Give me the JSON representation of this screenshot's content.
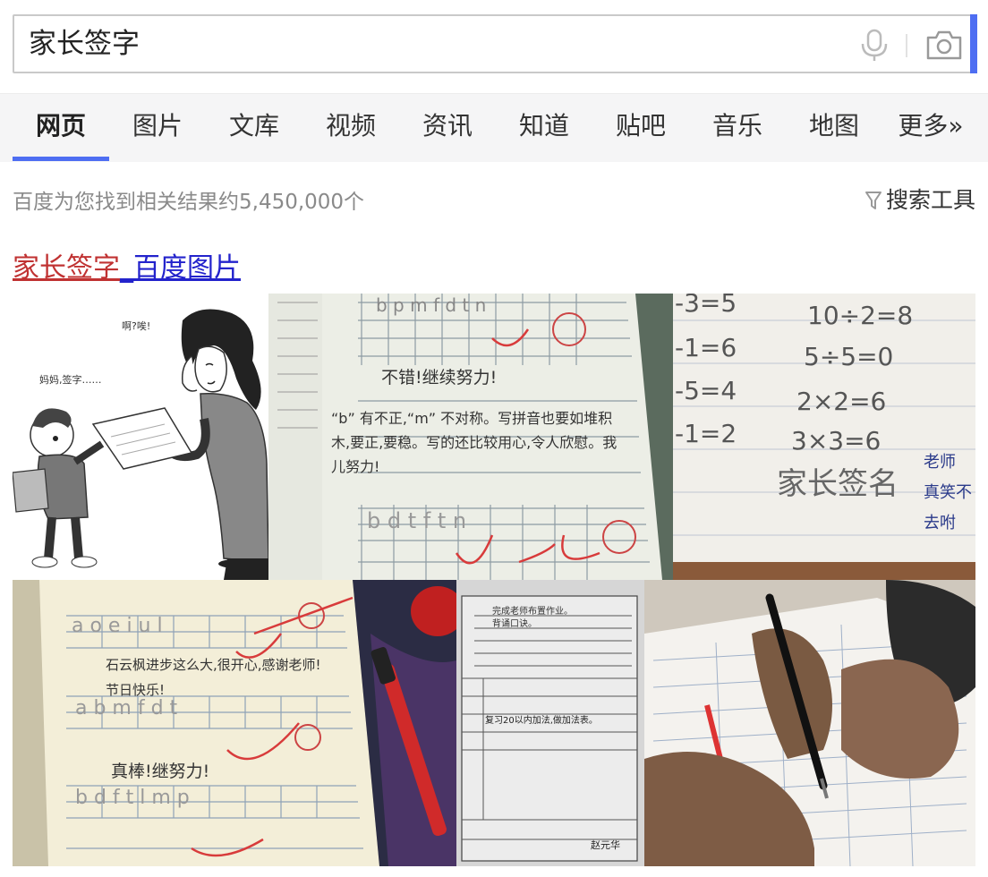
{
  "search": {
    "query": "家长签字"
  },
  "tabs": [
    {
      "label": "网页",
      "active": true
    },
    {
      "label": "图片"
    },
    {
      "label": "文库"
    },
    {
      "label": "视频"
    },
    {
      "label": "资讯"
    },
    {
      "label": "知道"
    },
    {
      "label": "贴吧"
    },
    {
      "label": "音乐"
    },
    {
      "label": "地图"
    },
    {
      "label": "更多»"
    }
  ],
  "results": {
    "count_text": "百度为您找到相关结果约5,450,000个",
    "tools_label": "搜索工具"
  },
  "result_title": {
    "keyword": "家长签字",
    "rest": "_百度图片"
  },
  "images": {
    "cartoon_mother_text": "啊?唉!",
    "cartoon_child_text": "妈妈,签字……",
    "comment_1": "不错!继续努力!",
    "comment_2": "“b” 有不正,“m” 不对称。写拼音也要如堆积木,要正,要稳。写的还比较用心,令人欣慰。我儿努力!",
    "math_lines": [
      "-3=5",
      "10÷2=8",
      "-1=6",
      "5÷5=0",
      "-5=4",
      "2×2=6",
      "-1=2",
      "3×3=6"
    ],
    "math_sign": "家长签名",
    "teacher_note": "老师 真笑不 去咐",
    "notebook_comment_1": "石云枫进步这么大,很开心,感谢老师!",
    "notebook_comment_2": "节日快乐!",
    "notebook_comment_3": "真棒!继努力!",
    "form_item_1": "完成老师布置作业。",
    "form_item_2": "背诵口诀。",
    "form_item_3": "复习20以内加法,做加法表。",
    "form_signature": "赵元华"
  },
  "colors": {
    "accent": "#4e6ef2",
    "keyword_red": "#c03232",
    "link_blue": "#2323cc"
  }
}
